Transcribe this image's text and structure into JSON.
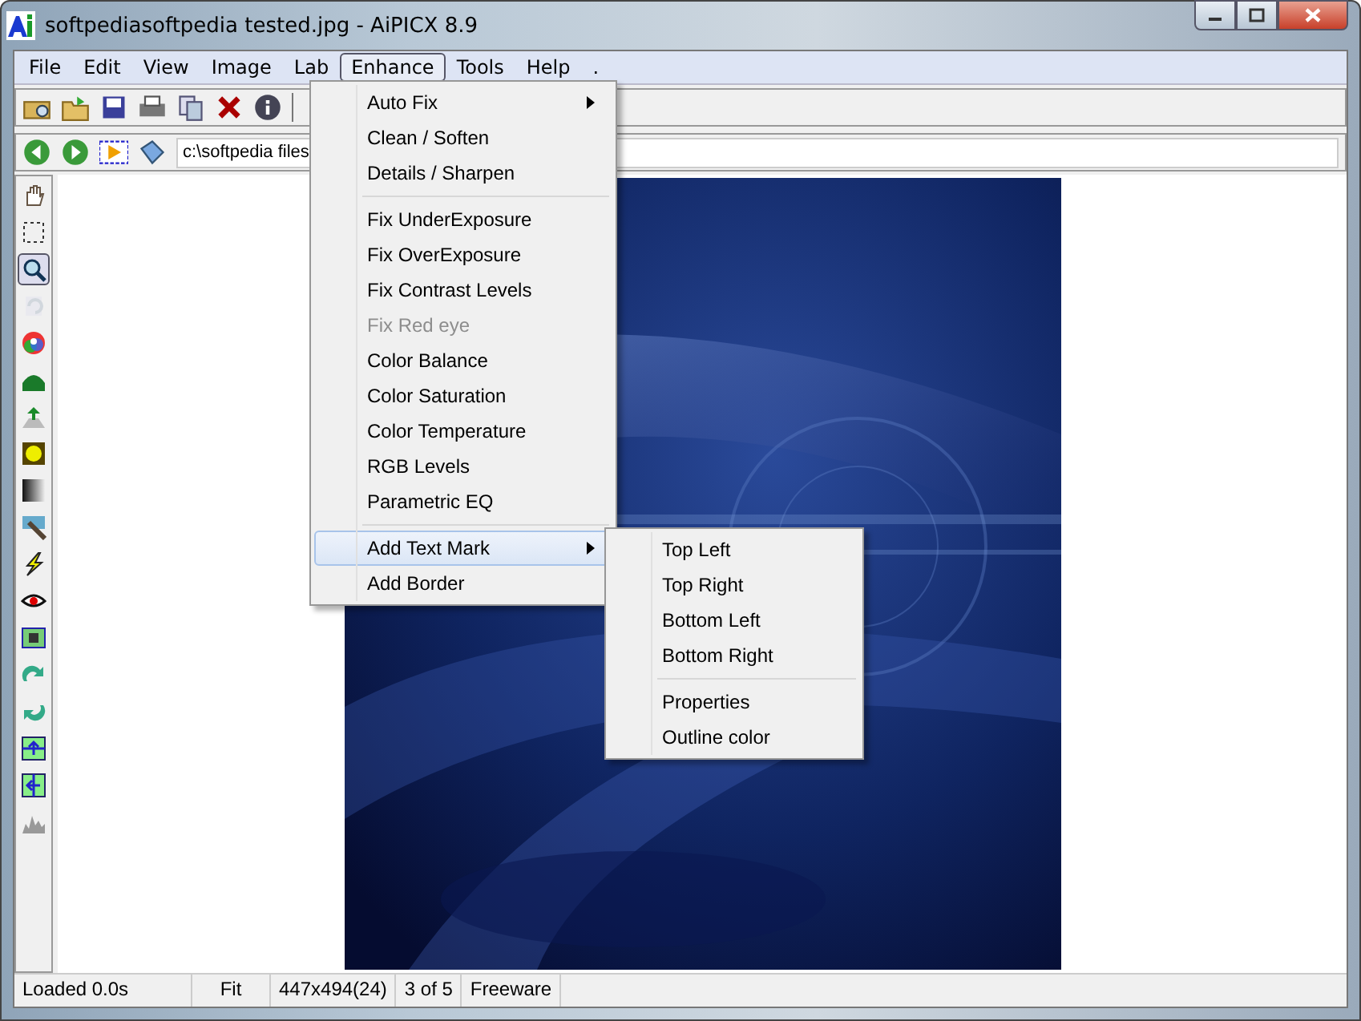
{
  "window": {
    "title": "softpediasoftpedia tested.jpg - AiPICX 8.9"
  },
  "menu_bar": [
    {
      "label": "File",
      "selected": false
    },
    {
      "label": "Edit",
      "selected": false
    },
    {
      "label": "View",
      "selected": false
    },
    {
      "label": "Image",
      "selected": false
    },
    {
      "label": "Lab",
      "selected": false
    },
    {
      "label": "Enhance",
      "selected": true
    },
    {
      "label": "Tools",
      "selected": false
    },
    {
      "label": "Help",
      "selected": false
    },
    {
      "label": ".",
      "selected": false
    }
  ],
  "path_field": {
    "value": "c:\\softpedia files"
  },
  "tools": [
    {
      "selected": false,
      "disabled": false
    },
    {
      "selected": false,
      "disabled": false
    },
    {
      "selected": true,
      "disabled": false
    },
    {
      "selected": false,
      "disabled": true
    },
    {
      "selected": false,
      "disabled": false
    },
    {
      "selected": false,
      "disabled": false
    },
    {
      "selected": false,
      "disabled": false
    },
    {
      "selected": false,
      "disabled": false
    },
    {
      "selected": false,
      "disabled": false
    },
    {
      "selected": false,
      "disabled": false
    },
    {
      "selected": false,
      "disabled": false
    },
    {
      "selected": false,
      "disabled": false
    },
    {
      "selected": false,
      "disabled": false
    },
    {
      "selected": false,
      "disabled": false
    },
    {
      "selected": false,
      "disabled": false
    },
    {
      "selected": false,
      "disabled": false
    },
    {
      "selected": false,
      "disabled": false
    },
    {
      "selected": false,
      "disabled": false
    }
  ],
  "enhance_menu": {
    "groups": [
      [
        {
          "label": "Auto Fix",
          "submenu": true,
          "disabled": false,
          "selected": false
        },
        {
          "label": "Clean / Soften",
          "submenu": false,
          "disabled": false,
          "selected": false
        },
        {
          "label": "Details / Sharpen",
          "submenu": false,
          "disabled": false,
          "selected": false
        }
      ],
      [
        {
          "label": "Fix UnderExposure",
          "submenu": false,
          "disabled": false,
          "selected": false
        },
        {
          "label": "Fix OverExposure",
          "submenu": false,
          "disabled": false,
          "selected": false
        },
        {
          "label": "Fix Contrast Levels",
          "submenu": false,
          "disabled": false,
          "selected": false
        },
        {
          "label": "Fix Red eye",
          "submenu": false,
          "disabled": true,
          "selected": false
        },
        {
          "label": "Color Balance",
          "submenu": false,
          "disabled": false,
          "selected": false
        },
        {
          "label": "Color Saturation",
          "submenu": false,
          "disabled": false,
          "selected": false
        },
        {
          "label": "Color Temperature",
          "submenu": false,
          "disabled": false,
          "selected": false
        },
        {
          "label": "RGB Levels",
          "submenu": false,
          "disabled": false,
          "selected": false
        },
        {
          "label": "Parametric EQ",
          "submenu": false,
          "disabled": false,
          "selected": false
        }
      ],
      [
        {
          "label": "Add Text Mark",
          "submenu": true,
          "disabled": false,
          "selected": true
        },
        {
          "label": "Add Border",
          "submenu": false,
          "disabled": false,
          "selected": false
        }
      ]
    ]
  },
  "text_mark_menu": {
    "groups": [
      [
        {
          "label": "Top Left",
          "submenu": false,
          "disabled": false,
          "selected": false
        },
        {
          "label": "Top Right",
          "submenu": false,
          "disabled": false,
          "selected": false
        },
        {
          "label": "Bottom Left",
          "submenu": false,
          "disabled": false,
          "selected": false
        },
        {
          "label": "Bottom Right",
          "submenu": false,
          "disabled": false,
          "selected": false
        }
      ],
      [
        {
          "label": "Properties",
          "submenu": false,
          "disabled": false,
          "selected": false
        },
        {
          "label": "Outline color",
          "submenu": false,
          "disabled": false,
          "selected": false
        }
      ]
    ]
  },
  "status_bar": [
    "Loaded 0.0s",
    "Fit",
    "447x494(24)",
    "3 of 5",
    "Freeware"
  ]
}
